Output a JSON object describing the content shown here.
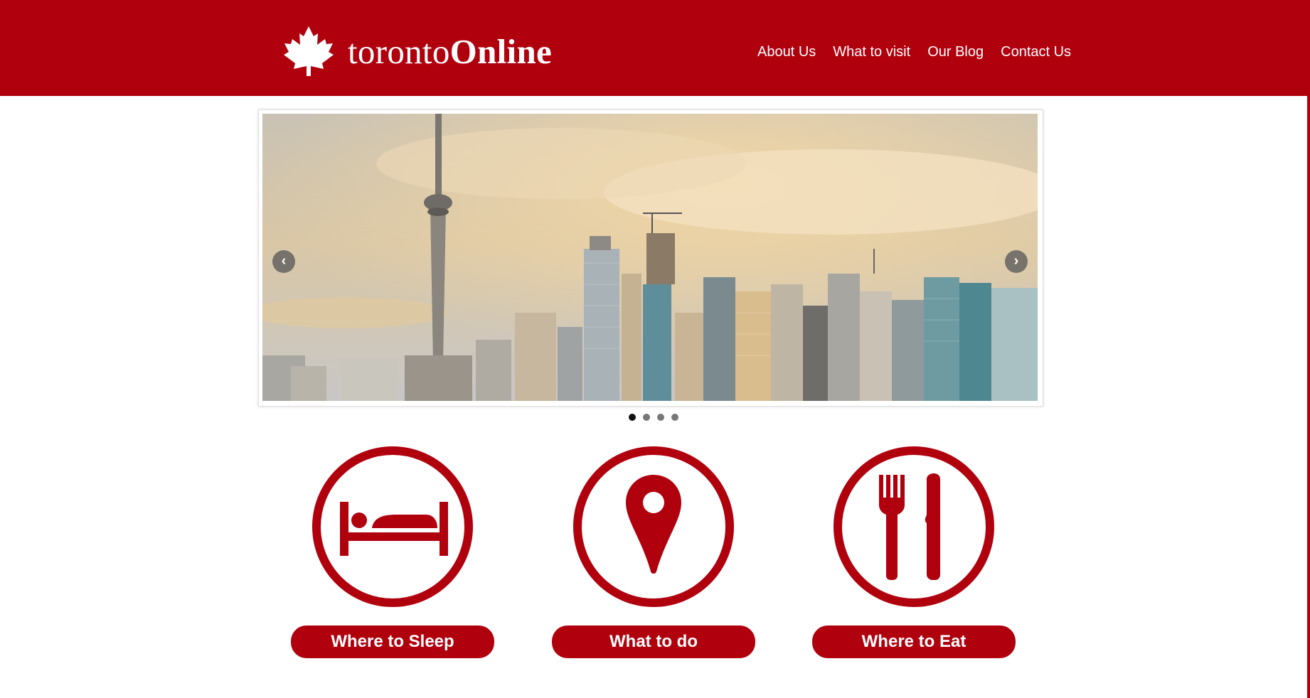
{
  "brand": {
    "name_light": "toronto",
    "name_bold": "Online",
    "logo_icon": "maple-leaf-icon"
  },
  "nav": {
    "items": [
      {
        "label": "About Us"
      },
      {
        "label": "What to visit"
      },
      {
        "label": "Our Blog"
      },
      {
        "label": "Contact Us"
      }
    ]
  },
  "slider": {
    "prev_icon": "chevron-left-icon",
    "next_icon": "chevron-right-icon",
    "prev_label": "‹",
    "next_label": "›",
    "slide_count": 4,
    "active_slide": 1
  },
  "features": [
    {
      "label": "Where to Sleep",
      "icon": "bed-icon"
    },
    {
      "label": "What to do",
      "icon": "map-pin-icon"
    },
    {
      "label": "Where to Eat",
      "icon": "fork-knife-icon"
    }
  ],
  "colors": {
    "brand_red": "#b0000e",
    "text_on_brand": "#ffffff",
    "dot_active": "#111111",
    "dot_inactive": "#777777"
  }
}
